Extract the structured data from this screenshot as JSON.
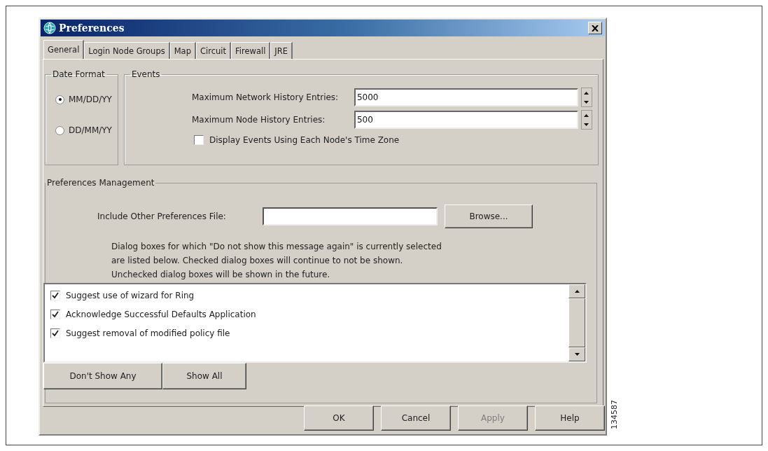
{
  "window": {
    "title": "Preferences"
  },
  "tabs": [
    {
      "label": "General",
      "selected": true
    },
    {
      "label": "Login Node Groups",
      "selected": false
    },
    {
      "label": "Map",
      "selected": false
    },
    {
      "label": "Circuit",
      "selected": false
    },
    {
      "label": "Firewall",
      "selected": false
    },
    {
      "label": "JRE",
      "selected": false
    }
  ],
  "date_format": {
    "title": "Date Format",
    "options": [
      {
        "label": "MM/DD/YY",
        "selected": true
      },
      {
        "label": "DD/MM/YY",
        "selected": false
      }
    ]
  },
  "events": {
    "title": "Events",
    "fields": [
      {
        "label": "Maximum Network History Entries:",
        "value": "5000"
      },
      {
        "label": "Maximum Node History Entries:",
        "value": "500"
      }
    ],
    "checkbox": {
      "label": "Display Events Using Each Node's Time Zone",
      "checked": false
    }
  },
  "preferences_management": {
    "title": "Preferences Management",
    "file_label": "Include Other Preferences File:",
    "browse": "Browse...",
    "description_lines": [
      "Dialog boxes for which \"Do not show this message again\" is currently selected",
      "are listed below. Checked dialog boxes will continue to not be shown.",
      "Unchecked dialog boxes will be shown in the future."
    ],
    "items": [
      {
        "label": "Suggest use of wizard for Ring",
        "checked": true
      },
      {
        "label": "Acknowledge Successful Defaults Application",
        "checked": true
      },
      {
        "label": "Suggest removal of modified policy file",
        "checked": true
      }
    ],
    "buttons": [
      "Don't Show Any",
      "Show All"
    ]
  },
  "buttons": [
    {
      "label": "OK",
      "disabled": false
    },
    {
      "label": "Cancel",
      "disabled": false
    },
    {
      "label": "Apply",
      "disabled": true
    },
    {
      "label": "Help",
      "disabled": false
    }
  ],
  "figure_id": "134587"
}
